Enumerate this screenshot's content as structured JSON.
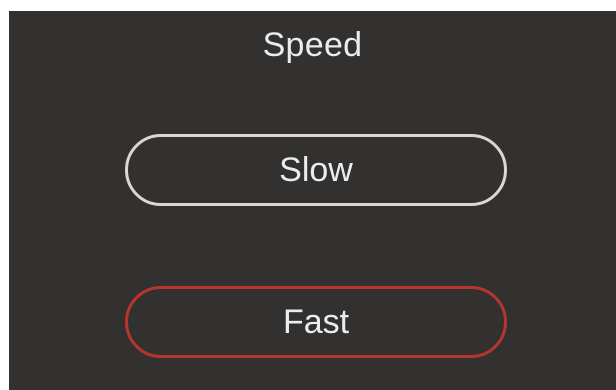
{
  "screen": {
    "title": "Speed"
  },
  "options": [
    {
      "label": "Slow",
      "state": "default",
      "border_color": "#d9d6d3"
    },
    {
      "label": "Fast",
      "state": "selected",
      "border_color": "#b6352d"
    }
  ],
  "colors": {
    "background": "#333130",
    "text": "#ebebeb",
    "accent": "#b6352d"
  }
}
